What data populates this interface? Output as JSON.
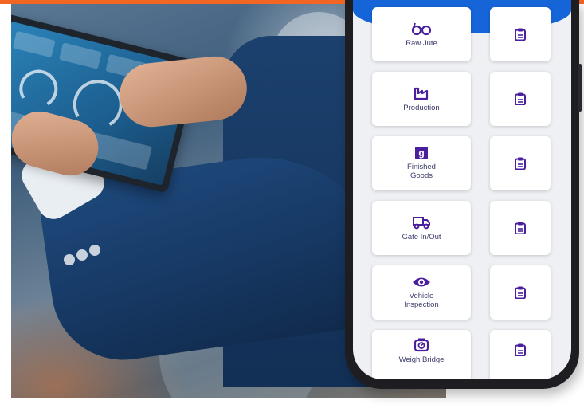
{
  "colors": {
    "accent_orange": "#f26522",
    "app_blue": "#1565d8",
    "icon_purple": "#4a1f9e",
    "label_text": "#3a3a6a"
  },
  "menu": {
    "items": [
      {
        "label": "Raw Jute",
        "icon": "glasses-icon"
      },
      {
        "label": "Production",
        "icon": "factory-icon"
      },
      {
        "label": "Finished Goods",
        "icon": "goods-box-icon"
      },
      {
        "label": "Gate In/Out",
        "icon": "truck-icon"
      },
      {
        "label": "Vehicle Inspection",
        "icon": "eye-icon"
      },
      {
        "label": "Weigh Bridge",
        "icon": "scale-icon"
      }
    ],
    "side_icon": "clipboard-icon"
  },
  "goods_icon_letter": "g"
}
